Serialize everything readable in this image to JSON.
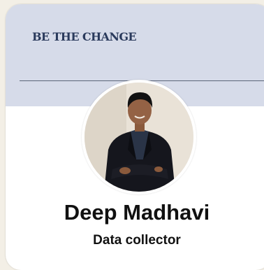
{
  "banner": {
    "title": "BE THE CHANGE",
    "background": "#d6dbe9",
    "title_color": "#2a3a5c"
  },
  "profile": {
    "name": "Deep Madhavi",
    "role": "Data collector",
    "avatar_icon": "person-photo"
  }
}
